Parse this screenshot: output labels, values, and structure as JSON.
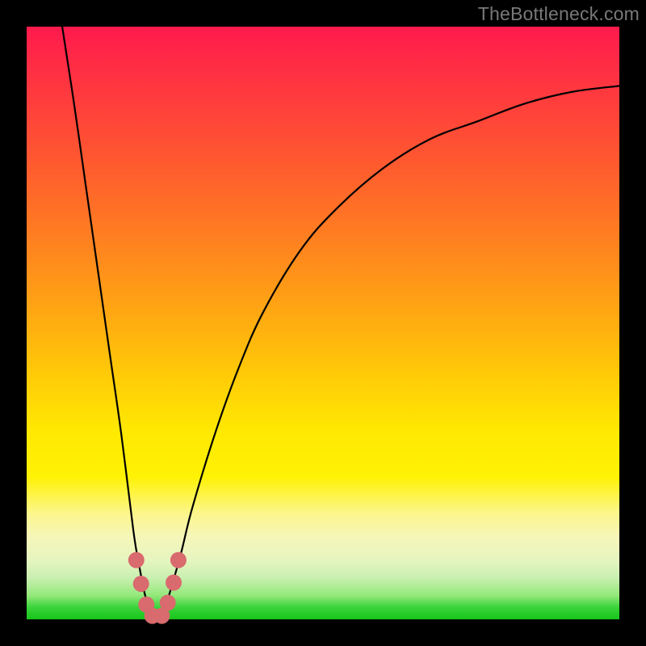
{
  "watermark": "TheBottleneck.com",
  "chart_data": {
    "type": "line",
    "title": "",
    "xlabel": "",
    "ylabel": "",
    "xlim": [
      0,
      100
    ],
    "ylim": [
      0,
      100
    ],
    "grid": false,
    "legend": false,
    "series": [
      {
        "name": "bottleneck-curve",
        "x": [
          6,
          8,
          10,
          12,
          14,
          16,
          18,
          19,
          20,
          21,
          22,
          23,
          24,
          26,
          28,
          32,
          36,
          40,
          46,
          52,
          60,
          68,
          76,
          84,
          92,
          100
        ],
        "y": [
          100,
          87,
          73,
          59,
          45,
          31,
          15,
          9,
          4,
          1,
          0,
          1,
          4,
          11,
          19,
          32,
          43,
          52,
          62,
          69,
          76,
          81,
          84,
          87,
          89,
          90
        ]
      }
    ],
    "markers": {
      "name": "valley-dots",
      "color": "#d96a6e",
      "radius_px": 10,
      "points": [
        {
          "x": 18.5,
          "y": 10
        },
        {
          "x": 19.3,
          "y": 6
        },
        {
          "x": 20.2,
          "y": 2.5
        },
        {
          "x": 21.2,
          "y": 0.6
        },
        {
          "x": 22.8,
          "y": 0.6
        },
        {
          "x": 23.8,
          "y": 2.8
        },
        {
          "x": 24.8,
          "y": 6.2
        },
        {
          "x": 25.6,
          "y": 10
        }
      ]
    },
    "gradient_stops": [
      {
        "pos": 0.0,
        "color": "#ff1a4d"
      },
      {
        "pos": 0.34,
        "color": "#ff7a22"
      },
      {
        "pos": 0.68,
        "color": "#ffe802"
      },
      {
        "pos": 0.9,
        "color": "#e6f5c0"
      },
      {
        "pos": 1.0,
        "color": "#17c41a"
      }
    ]
  }
}
